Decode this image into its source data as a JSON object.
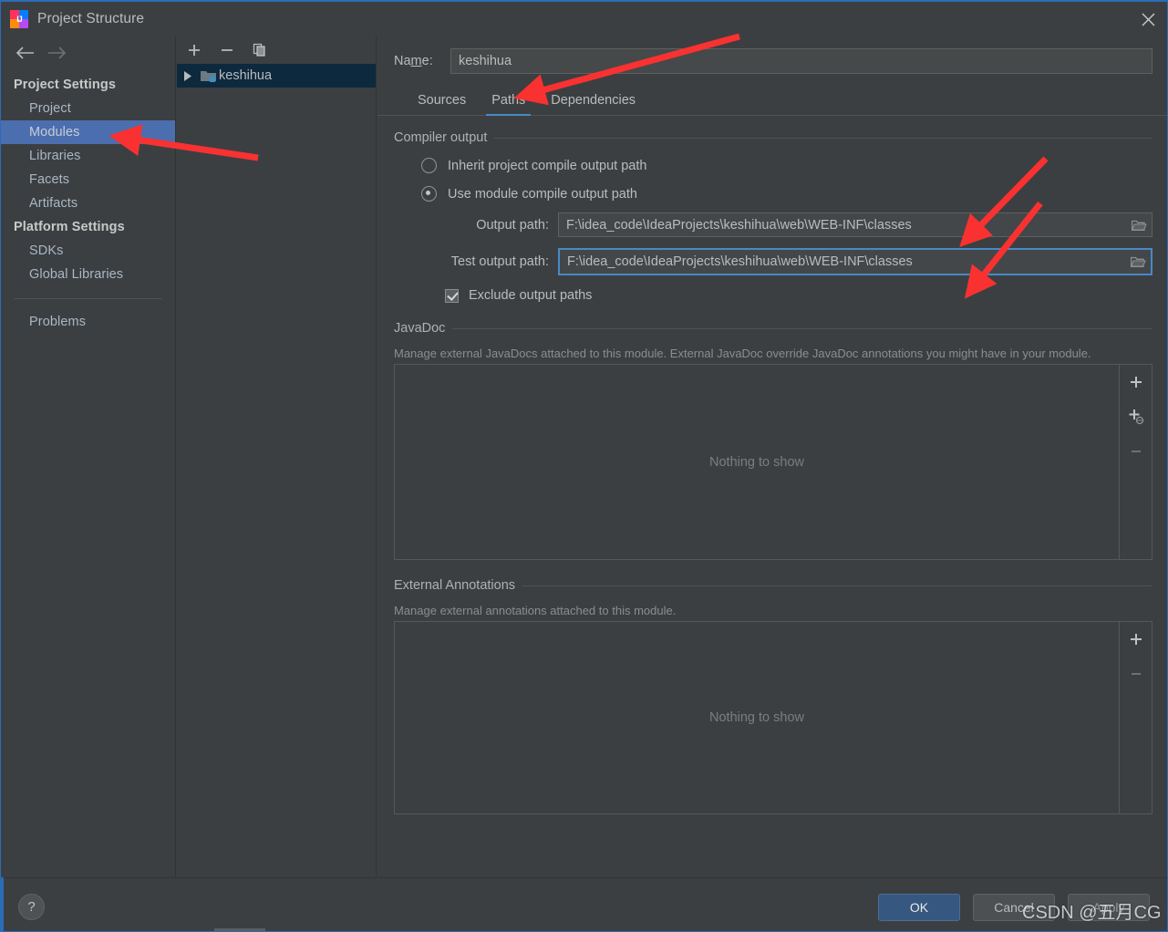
{
  "window": {
    "title": "Project Structure",
    "app_icon": "intellij-idea-icon",
    "close_icon": "close-icon"
  },
  "leftnav": {
    "back_icon": "arrow-left-icon",
    "forward_icon": "arrow-right-icon",
    "groups": [
      {
        "label": "Project Settings",
        "items": [
          {
            "label": "Project",
            "selected": false
          },
          {
            "label": "Modules",
            "selected": true
          },
          {
            "label": "Libraries",
            "selected": false
          },
          {
            "label": "Facets",
            "selected": false
          },
          {
            "label": "Artifacts",
            "selected": false
          }
        ]
      },
      {
        "label": "Platform Settings",
        "items": [
          {
            "label": "SDKs",
            "selected": false
          },
          {
            "label": "Global Libraries",
            "selected": false
          }
        ]
      }
    ],
    "problems_label": "Problems"
  },
  "tree": {
    "toolbar": [
      {
        "name": "add-module-button",
        "icon": "plus-icon"
      },
      {
        "name": "remove-module-button",
        "icon": "minus-icon"
      },
      {
        "name": "copy-module-button",
        "icon": "copy-icon"
      }
    ],
    "nodes": [
      {
        "label": "keshihua",
        "icon": "module-folder-icon",
        "expanded": false,
        "selected": true
      }
    ]
  },
  "main": {
    "name_label_pre": "Na",
    "name_label_mnemonic": "m",
    "name_label_post": "e:",
    "name_value": "keshihua",
    "tabs": [
      {
        "label": "Sources",
        "active": false
      },
      {
        "label": "Paths",
        "active": true
      },
      {
        "label": "Dependencies",
        "active": false
      }
    ],
    "compiler_output": {
      "legend": "Compiler output",
      "radio_inherit": "Inherit project compile output path",
      "radio_module": "Use module compile output path",
      "selected_radio": "module",
      "output_path_label": "Output path:",
      "output_path_value": "F:\\idea_code\\IdeaProjects\\keshihua\\web\\WEB-INF\\classes",
      "test_output_path_label": "Test output path:",
      "test_output_path_value": "F:\\idea_code\\IdeaProjects\\keshihua\\web\\WEB-INF\\classes",
      "browse_icon": "folder-browse-icon",
      "exclude_label": "Exclude output paths",
      "exclude_checked": true
    },
    "javadoc": {
      "legend": "JavaDoc",
      "hint": "Manage external JavaDocs attached to this module. External JavaDoc override JavaDoc annotations you might have in your module.",
      "empty_text": "Nothing to show",
      "tools": [
        {
          "name": "add-javadoc-path-button",
          "icon": "plus-icon",
          "enabled": true
        },
        {
          "name": "add-javadoc-url-button",
          "icon": "plus-globe-icon",
          "enabled": true
        },
        {
          "name": "remove-javadoc-button",
          "icon": "minus-icon",
          "enabled": false
        }
      ]
    },
    "annotations": {
      "legend": "External Annotations",
      "hint": "Manage external annotations attached to this module.",
      "empty_text": "Nothing to show",
      "tools": [
        {
          "name": "add-annotation-path-button",
          "icon": "plus-icon",
          "enabled": true
        },
        {
          "name": "remove-annotation-button",
          "icon": "minus-icon",
          "enabled": false
        }
      ]
    }
  },
  "footer": {
    "help_label": "?",
    "ok_label": "OK",
    "cancel_label": "Cancel",
    "apply_label": "Apply"
  },
  "watermark": "CSDN @五月CG",
  "colors": {
    "accent_blue": "#4b6eaf",
    "tab_underline": "#4a88c7",
    "ok_button": "#365880",
    "annotation_red": "#f93131",
    "panel_bg": "#3c3f41",
    "tree_selection": "#0d293e"
  }
}
